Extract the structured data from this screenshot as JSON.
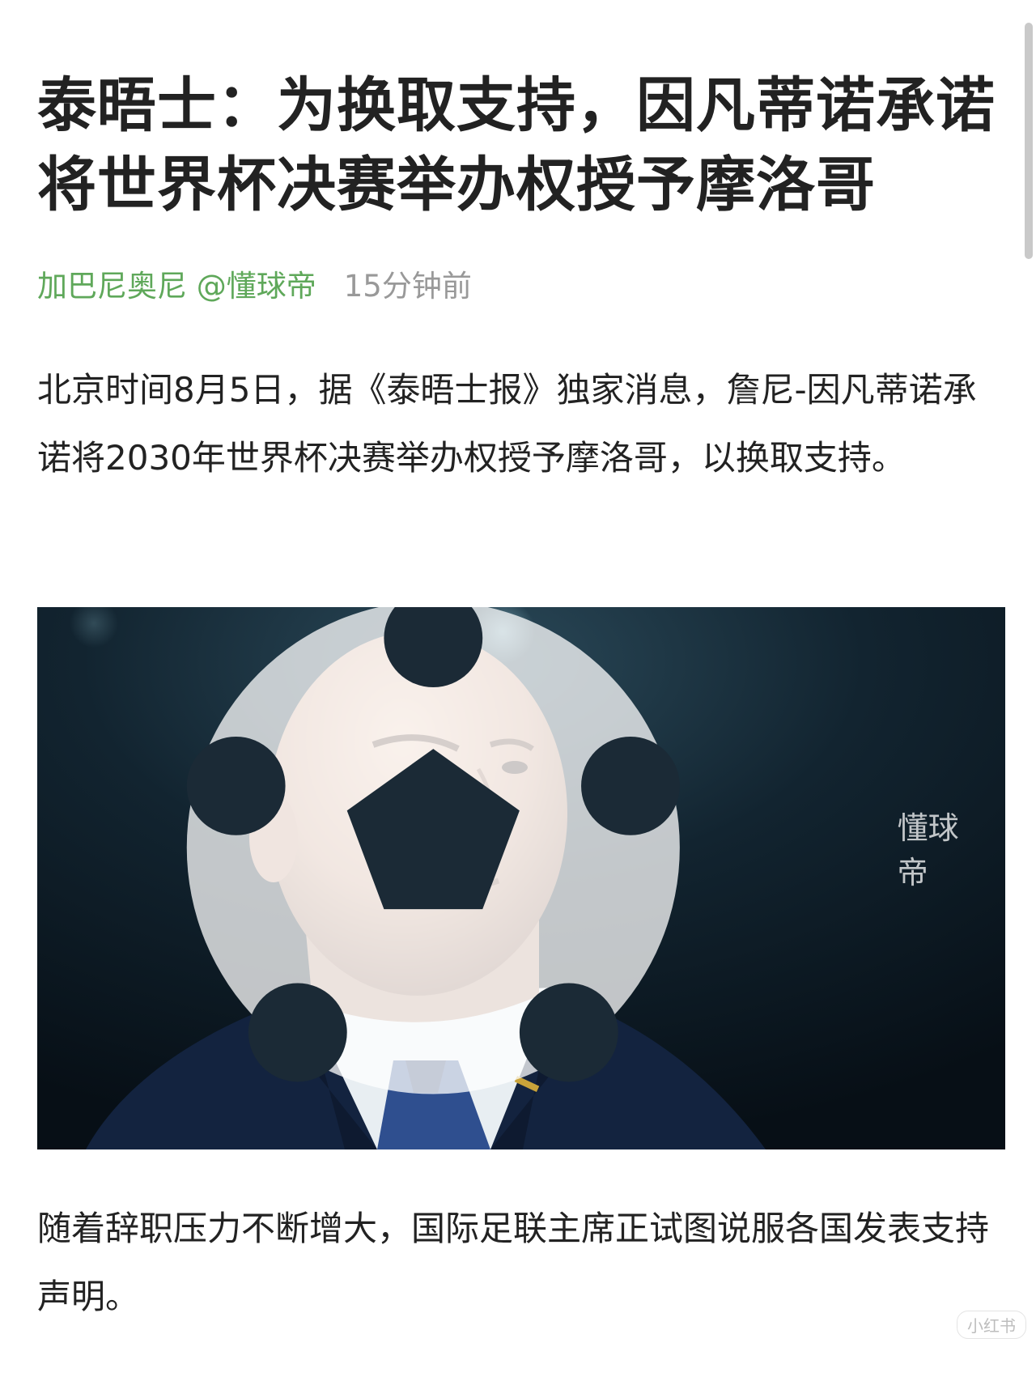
{
  "article": {
    "title": "泰晤士：为换取支持，因凡蒂诺承诺将世界杯决赛举办权授予摩洛哥",
    "author": "加巴尼奥尼 @懂球帝",
    "time": "15分钟前",
    "paragraphs": [
      "北京时间8月5日，据《泰晤士报》独家消息，詹尼-因凡蒂诺承诺将2030年世界杯决赛举办权授予摩洛哥，以换取支持。",
      "随着辞职压力不断增大，国际足联主席正试图说服各国发表支持声明。"
    ],
    "image": {
      "watermark": "懂球帝",
      "icon": "soccer-ball-icon"
    }
  },
  "corner_mark": "小红书",
  "colors": {
    "author": "#5fa85a",
    "time": "#999999",
    "text": "#222222",
    "photo_bg": "#0b1722"
  }
}
